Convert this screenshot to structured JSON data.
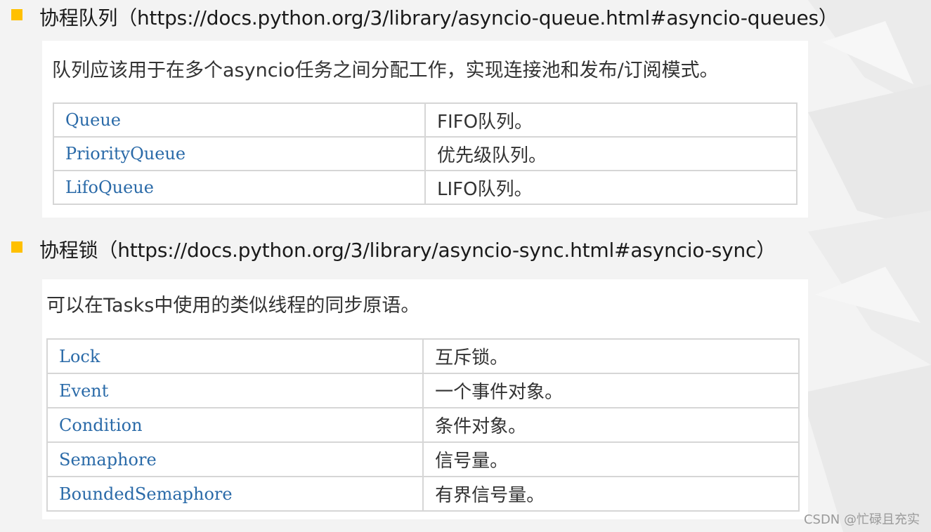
{
  "sections": [
    {
      "heading": "协程队列（https://docs.python.org/3/library/asyncio-queue.html#asyncio-queues）",
      "intro": "队列应该用于在多个asyncio任务之间分配工作，实现连接池和发布/订阅模式。",
      "rows": [
        {
          "name": "Queue",
          "desc": "FIFO队列。"
        },
        {
          "name": "PriorityQueue",
          "desc": "优先级队列。"
        },
        {
          "name": "LifoQueue",
          "desc": "LIFO队列。"
        }
      ]
    },
    {
      "heading": "协程锁（https://docs.python.org/3/library/asyncio-sync.html#asyncio-sync）",
      "intro": "可以在Tasks中使用的类似线程的同步原语。",
      "rows": [
        {
          "name": "Lock",
          "desc": "互斥锁。"
        },
        {
          "name": "Event",
          "desc": "一个事件对象。"
        },
        {
          "name": "Condition",
          "desc": "条件对象。"
        },
        {
          "name": "Semaphore",
          "desc": "信号量。"
        },
        {
          "name": "BoundedSemaphore",
          "desc": "有界信号量。"
        }
      ]
    }
  ],
  "watermark": "CSDN @忙碌且充实",
  "colors": {
    "bullet": "#ffc000",
    "class_name": "#2a6aa8",
    "border": "#d6d6d6",
    "background": "#f3f3f3"
  }
}
